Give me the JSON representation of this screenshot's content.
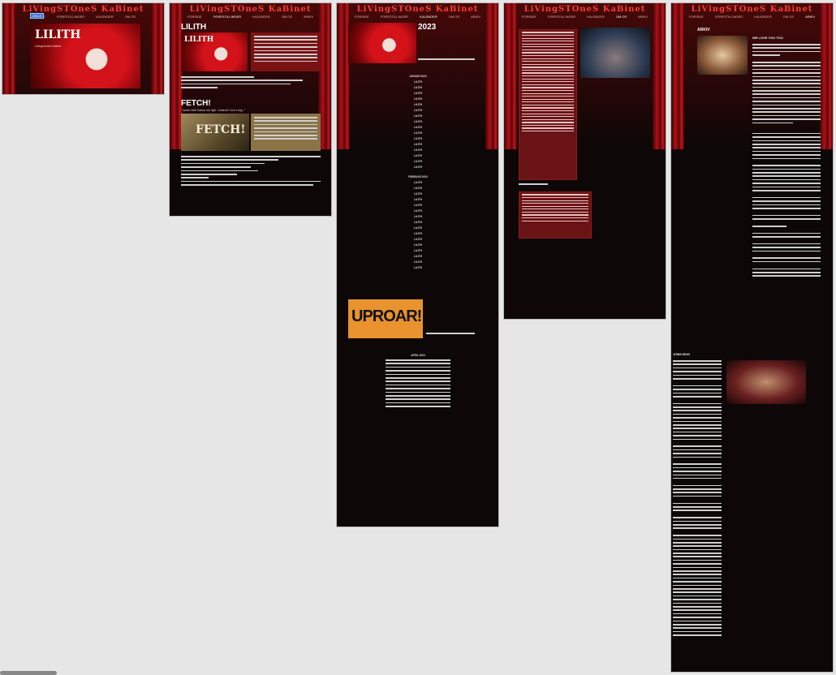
{
  "site": {
    "title": "LiVingSTOneS KaBinet",
    "nav": [
      "FORSIDE",
      "FORESTILLINGER",
      "KALENDER",
      "OM OS",
      "ARKIV"
    ],
    "tag": "DEUX"
  },
  "panel1": {
    "poster": {
      "title": "LILITH",
      "sub": "Livingstones Kabinet"
    }
  },
  "panel2": {
    "heading1": "LILITH",
    "heading2": "FETCH!",
    "quote": "\" harder drink Harsus ove right. I cleaned! I ove a dog...\"",
    "poster2_title": "FETCH!"
  },
  "panel3": {
    "year": "2023",
    "month1": "JANUAR 2023",
    "month2": "FEBRUAR 2023",
    "entry_show": "LILITH",
    "uproar_title": "UPROAR!",
    "month3": "APRIL 2023"
  },
  "panel5": {
    "arkiv": "ARKIV",
    "wlyt": "WE LOVE YOU TOO",
    "jobs": "JOBS BOG"
  },
  "colors": {
    "bg": "#0d0707",
    "accent": "#ff3b30",
    "curtain": "#b01017",
    "uproar": "#e8932e"
  }
}
